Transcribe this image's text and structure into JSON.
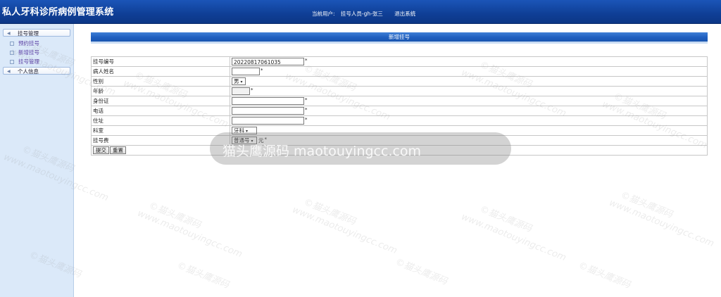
{
  "header": {
    "app_title": "私人牙科诊所病例管理系统",
    "current_user_label": "当前用户:",
    "current_user": "挂号人员-gh-张三",
    "logout": "退出系统"
  },
  "sidebar": {
    "groups": [
      {
        "label": "挂号管理",
        "items": [
          "预约挂号",
          "新增挂号",
          "挂号管理"
        ]
      },
      {
        "label": "个人信息",
        "items": []
      }
    ]
  },
  "main": {
    "panel_title": "新增挂号",
    "fields": {
      "reg_no": {
        "label": "挂号编号",
        "value": "20220817061035"
      },
      "patient_name": {
        "label": "病人姓名",
        "value": ""
      },
      "gender": {
        "label": "性别",
        "value": "男"
      },
      "age": {
        "label": "年龄",
        "value": ""
      },
      "id_card": {
        "label": "身份证",
        "value": ""
      },
      "phone": {
        "label": "电话",
        "value": ""
      },
      "address": {
        "label": "住址",
        "value": ""
      },
      "department": {
        "label": "科室",
        "value": "牙科"
      },
      "fee": {
        "label": "挂号费",
        "value": "普通号",
        "unit": "元"
      }
    },
    "required_mark": "*",
    "buttons": {
      "submit": "提交",
      "reset": "重置"
    }
  },
  "watermark": {
    "text": "©猫头鹰源码",
    "url": "www.maotouyingcc.com",
    "overlay": "猫头鹰源码 maotouyingcc.com"
  }
}
